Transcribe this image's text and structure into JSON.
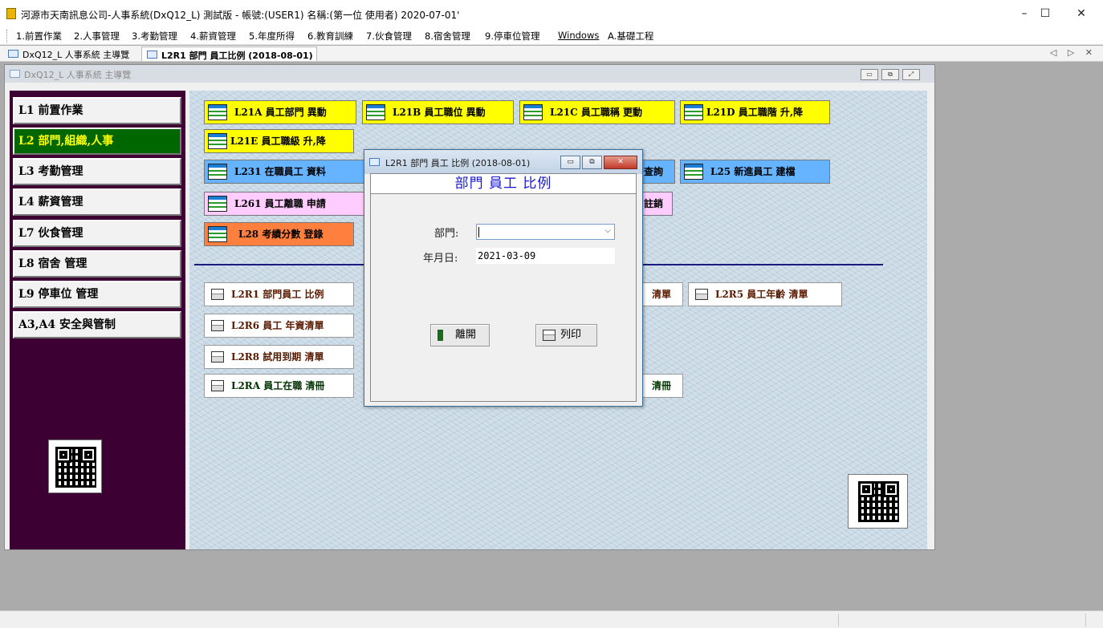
{
  "titlebar": {
    "title": "河源市天南訊息公司-人事系統(DxQ12_L) 測試版 - 帳號:(USER1) 名稱:(第一位 使用者) 2020-07-01'",
    "minimize": "–",
    "maximize": "☐",
    "close": "✕"
  },
  "menu": [
    "1.前置作業",
    "2.人事管理",
    "3.考勤管理",
    "4.薪資管理",
    "5.年度所得",
    "6.教育訓練",
    "7.伙食管理",
    "8.宿舍管理",
    "9.停車位管理",
    "Windows",
    "A.基礎工程"
  ],
  "tabs": [
    {
      "label": "DxQ12_L 人事系統 主導覽"
    },
    {
      "label": "L2R1 部門 員工比例 (2018-08-01)"
    }
  ],
  "tabnav": "◁ ▷ ✕",
  "mdi": {
    "title": "DxQ12_L 人事系統 主導覽",
    "btn_min": "▭",
    "btn_restore": "⧉",
    "btn_close": "⤢"
  },
  "sidebar": [
    "L1 前置作業",
    "L2 部門,組織,人事",
    "L3 考勤管理",
    "L4 薪資管理",
    "L7 伙食管理",
    "L8 宿舍 管理",
    "L9 停車位 管理",
    "A3,A4 安全與管制"
  ],
  "modules": {
    "l21a": "L21A 員工部門 異動",
    "l21b": "L21B 員工職位 異動",
    "l21c": "L21C 員工職稱 更動",
    "l21d": "L21D 員工職階 升,降",
    "l21e": "L21E 員工職級 升,降",
    "l231": "L231 在職員工 資料",
    "l23_partial": "查詢",
    "l25": "L25  新進員工 建檔",
    "l261": "L261 員工離職 申請",
    "l26_partial": "註銷",
    "l28": "L28 考績分數 登錄"
  },
  "reports": {
    "l2r1": "L2R1 部門員工 比例",
    "l2r4_partial": "清單",
    "l2r5": "L2R5 員工年齡 清單",
    "l2r6": "L2R6 員工 年資清單",
    "l2r8": "L2R8 試用到期 清單",
    "l2ra": "L2RA 員工在職 清冊",
    "l2rb_partial": "清冊"
  },
  "dialog": {
    "title": "L2R1 部門 員工 比例 (2018-08-01)",
    "heading": "部門 員工 比例",
    "dept_label": "部門:",
    "dept_value": "",
    "date_label": "年月日:",
    "date_value": "2021-03-09",
    "exit_label": "離開",
    "print_label": "列印",
    "btn_min": "▭",
    "btn_restore": "⧉",
    "btn_close": "✕"
  },
  "colors": {
    "sidebar_bg": "#3d0033",
    "sidebar_active_bg": "#006600",
    "sidebar_active_text": "#ffff00",
    "module_yellow": "#ffff00",
    "module_blue": "#66b3ff",
    "module_pink": "#ffccff",
    "module_orange": "#ff7f3f",
    "dialog_heading": "#1a1ad0"
  }
}
